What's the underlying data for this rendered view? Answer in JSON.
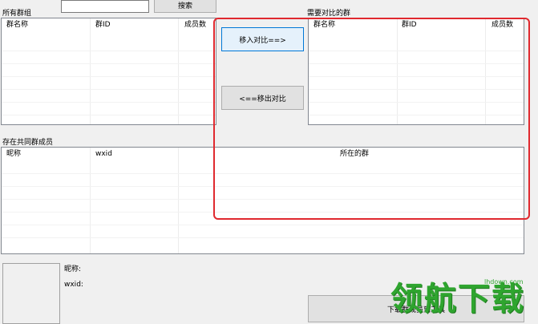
{
  "top": {
    "all_groups_label": "所有群组",
    "search_placeholder": "",
    "search_button": "搜索"
  },
  "compare": {
    "title": "需要对比的群",
    "move_in_button": "移入对比==>",
    "move_out_button": "<==移出对比"
  },
  "left_table": {
    "columns": [
      "群名称",
      "群ID",
      "成员数"
    ]
  },
  "right_table": {
    "columns": [
      "群名称",
      "群ID",
      "成员数"
    ]
  },
  "members": {
    "title": "存在共同群成员",
    "columns": [
      "昵称",
      "wxid",
      "所在的群"
    ]
  },
  "detail": {
    "nickname_label": "昵称:",
    "wxid_label": "wxid:"
  },
  "bottom_button": "下载群成员到工具",
  "watermark": {
    "brand": "领航下载",
    "url": "lhdown.com"
  },
  "colors": {
    "highlight": "#e0292f",
    "watermark": "#2fa52f"
  }
}
